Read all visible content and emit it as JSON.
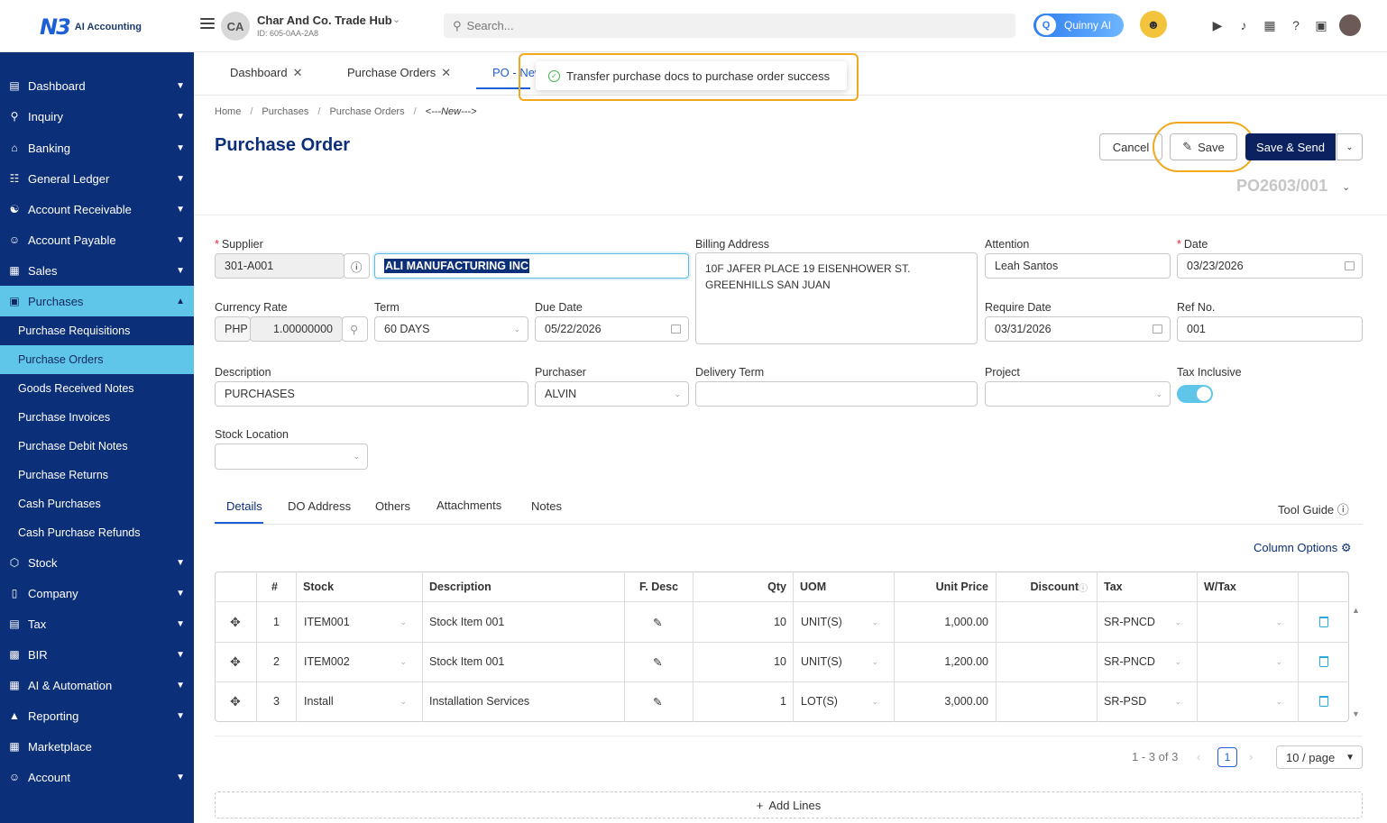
{
  "app": {
    "logo_mark": "N3",
    "logo_text": "AI Accounting"
  },
  "header": {
    "company_initials": "CA",
    "company_name": "Char And Co. Trade Hub",
    "company_id": "ID: 605-0AA-2A8",
    "search_placeholder": "Search...",
    "assistant_label": "Quinny AI"
  },
  "sidebar": {
    "items": [
      {
        "label": "Dashboard",
        "icon": "dashboard-icon"
      },
      {
        "label": "Inquiry",
        "icon": "inquiry-icon"
      },
      {
        "label": "Banking",
        "icon": "bank-icon"
      },
      {
        "label": "General Ledger",
        "icon": "ledger-icon"
      },
      {
        "label": "Account Receivable",
        "icon": "receivable-icon"
      },
      {
        "label": "Account Payable",
        "icon": "payable-icon"
      },
      {
        "label": "Sales",
        "icon": "sales-icon"
      },
      {
        "label": "Purchases",
        "icon": "purchases-icon"
      },
      {
        "label": "Stock",
        "icon": "stock-icon"
      },
      {
        "label": "Company",
        "icon": "company-icon"
      },
      {
        "label": "Tax",
        "icon": "tax-icon"
      },
      {
        "label": "BIR",
        "icon": "bir-icon"
      },
      {
        "label": "AI & Automation",
        "icon": "automation-icon"
      },
      {
        "label": "Reporting",
        "icon": "reporting-icon"
      },
      {
        "label": "Marketplace",
        "icon": "marketplace-icon"
      },
      {
        "label": "Account",
        "icon": "account-icon"
      }
    ],
    "purchases_sub": [
      "Purchase Requisitions",
      "Purchase Orders",
      "Goods Received Notes",
      "Purchase Invoices",
      "Purchase Debit Notes",
      "Purchase Returns",
      "Cash Purchases",
      "Cash Purchase Refunds"
    ]
  },
  "page_tabs": [
    {
      "label": "Dashboard"
    },
    {
      "label": "Purchase Orders"
    },
    {
      "label": "PO - New"
    }
  ],
  "toast": {
    "message": "Transfer purchase docs to purchase order success"
  },
  "breadcrumb": [
    "Home",
    "Purchases",
    "Purchase Orders",
    "<---New--->"
  ],
  "page_title": "Purchase Order",
  "actions": {
    "cancel": "Cancel",
    "save": "Save",
    "save_send": "Save & Send"
  },
  "po_number": "PO2603/001",
  "form": {
    "supplier_label": "Supplier",
    "supplier_code": "301-A001",
    "supplier_name": "ALI MANUFACTURING INC",
    "billing_label": "Billing Address",
    "billing_line1": "10F JAFER PLACE 19 EISENHOWER ST.",
    "billing_line2": "GREENHILLS SAN JUAN",
    "attention_label": "Attention",
    "attention": "Leah Santos",
    "date_label": "Date",
    "date": "03/23/2026",
    "currency_rate_label": "Currency Rate",
    "currency": "PHP",
    "rate": "1.00000000",
    "term_label": "Term",
    "term": "60 DAYS",
    "due_date_label": "Due Date",
    "due_date": "05/22/2026",
    "require_date_label": "Require Date",
    "require_date": "03/31/2026",
    "ref_label": "Ref No.",
    "ref": "001",
    "description_label": "Description",
    "description": "PURCHASES",
    "purchaser_label": "Purchaser",
    "purchaser": "ALVIN",
    "delivery_term_label": "Delivery Term",
    "delivery_term": "",
    "project_label": "Project",
    "project": "",
    "tax_inclusive_label": "Tax Inclusive",
    "tax_inclusive": true,
    "stock_location_label": "Stock Location",
    "stock_location": ""
  },
  "detail_tabs": [
    "Details",
    "DO Address",
    "Others",
    "Attachments",
    "Notes"
  ],
  "tool_guide": "Tool Guide",
  "column_options": "Column Options",
  "table": {
    "headers": [
      "#",
      "Stock",
      "Description",
      "F. Desc",
      "Qty",
      "UOM",
      "Unit Price",
      "Discount",
      "Tax",
      "W/Tax"
    ],
    "rows": [
      {
        "no": "1",
        "stock": "ITEM001",
        "description": "Stock Item 001",
        "qty": "10",
        "uom": "UNIT(S)",
        "unit_price": "1,000.00",
        "discount": "",
        "tax": "SR-PNCD",
        "wtax": ""
      },
      {
        "no": "2",
        "stock": "ITEM002",
        "description": "Stock Item 001",
        "qty": "10",
        "uom": "UNIT(S)",
        "unit_price": "1,200.00",
        "discount": "",
        "tax": "SR-PNCD",
        "wtax": ""
      },
      {
        "no": "3",
        "stock": "Install",
        "description": "Installation Services",
        "qty": "1",
        "uom": "LOT(S)",
        "unit_price": "3,000.00",
        "discount": "",
        "tax": "SR-PSD",
        "wtax": ""
      }
    ]
  },
  "pagination": {
    "range": "1 - 3 of 3",
    "current": "1",
    "page_size": "10 / page"
  },
  "add_lines": "Add Lines",
  "colors": {
    "sidebar": "#0c2f7a",
    "active": "#5fc6ea",
    "highlight": "#f2a81d",
    "primary": "#0c2260"
  }
}
